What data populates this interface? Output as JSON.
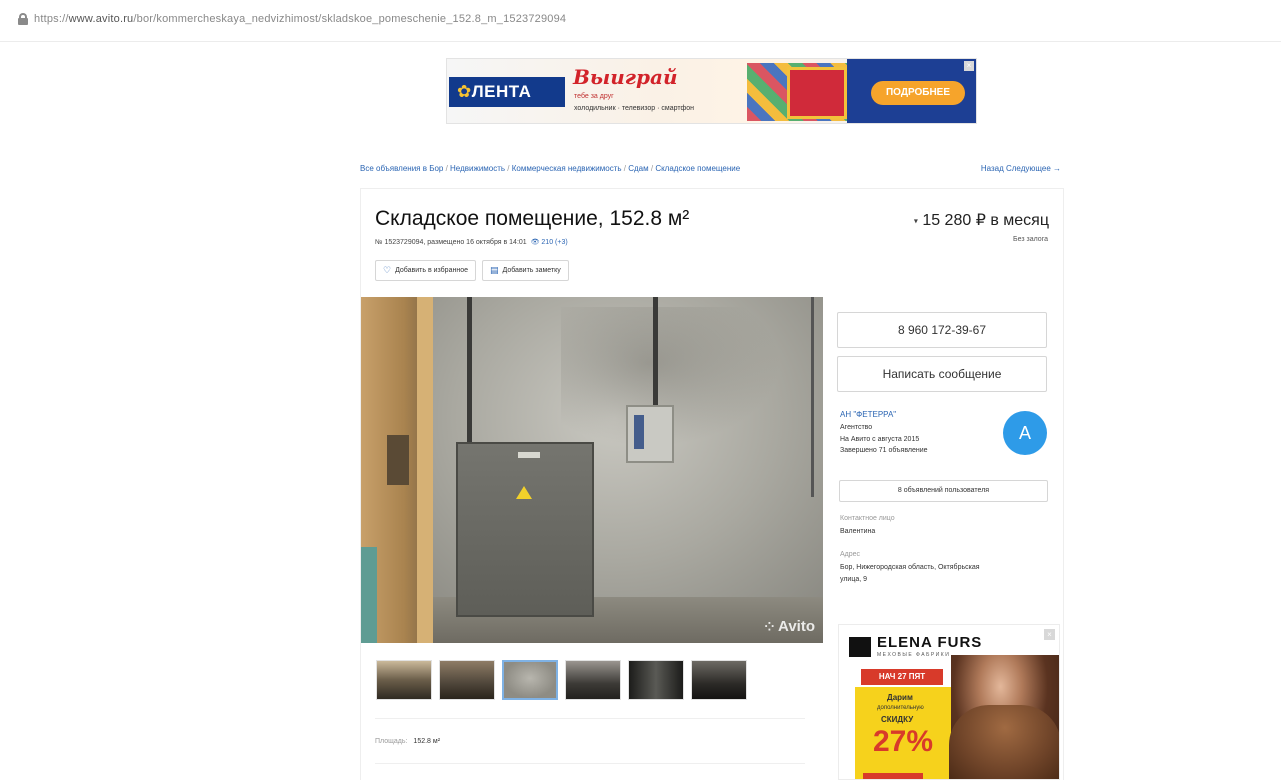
{
  "browser": {
    "url_prefix": "https://",
    "url_domain": "www.avito.ru",
    "url_path": "/bor/kommercheskaya_nedvizhimost/skladskoe_pomeschenie_152.8_m_1523729094"
  },
  "banner": {
    "brand": "ЛЕНТА",
    "headline": "Выиграй",
    "line1": "тебе за друг",
    "line2": "холодильник · телевизор · смартфон",
    "cta": "ПОДРОБНЕЕ",
    "close_icon": "close-icon"
  },
  "breadcrumbs": {
    "items": [
      "Все объявления в Бор",
      "Недвижимость",
      "Коммерческая недвижимость",
      "Сдам",
      "Складское помещение"
    ],
    "separator": " / ",
    "nav": "Назад  Следующее →"
  },
  "listing": {
    "title": "Складское помещение, 152.8 м²",
    "meta_prefix": "№ 1523729094, размещено 16 октября в 14:01",
    "views": "👁 210 (+3)",
    "favorite_label": "Добавить в избранное",
    "note_label": "Добавить заметку",
    "price_prefix": "▾",
    "price": "15 280 ₽ в месяц",
    "deposit": "Без залога",
    "watermark": "Avito",
    "area_label": "Площадь:",
    "area_value": "152.8 м²"
  },
  "thumbnails": [
    {
      "id": "photo-1",
      "active": false
    },
    {
      "id": "photo-2",
      "active": false
    },
    {
      "id": "photo-3",
      "active": true
    },
    {
      "id": "photo-4",
      "active": false
    },
    {
      "id": "photo-5",
      "active": false
    },
    {
      "id": "photo-6",
      "active": false
    }
  ],
  "seller": {
    "phone": "8 960 172-39-67",
    "message_button": "Написать сообщение",
    "name": "АН \"ФЕТЕРРА\"",
    "type": "Агентство",
    "since": "На Авито с августа 2015",
    "completed": "Завершено 71 объявление",
    "avatar_letter": "А",
    "ads_button": "8 объявлений пользователя",
    "contact_label": "Контактное лицо",
    "contact_name": "Валентина",
    "address_label": "Адрес",
    "address_line1": "Бор, Нижегородская область, Октябрьская",
    "address_line2": "улица, 9"
  },
  "side_ad": {
    "brand": "ELENA FURS",
    "subtitle": "МЕХОВЫЕ ФАБРИКИ",
    "date": "НАЧ 27 ПЯТ",
    "promo1": "Дарим",
    "promo2": "дополнительную",
    "promo3": "СКИДКУ",
    "percent": "27%"
  },
  "colors": {
    "link": "#2b65b3",
    "avatar": "#2e9be8",
    "promo_red": "#d83a2a",
    "promo_yellow": "#f6d21c",
    "lenta_blue": "#123a8c"
  }
}
